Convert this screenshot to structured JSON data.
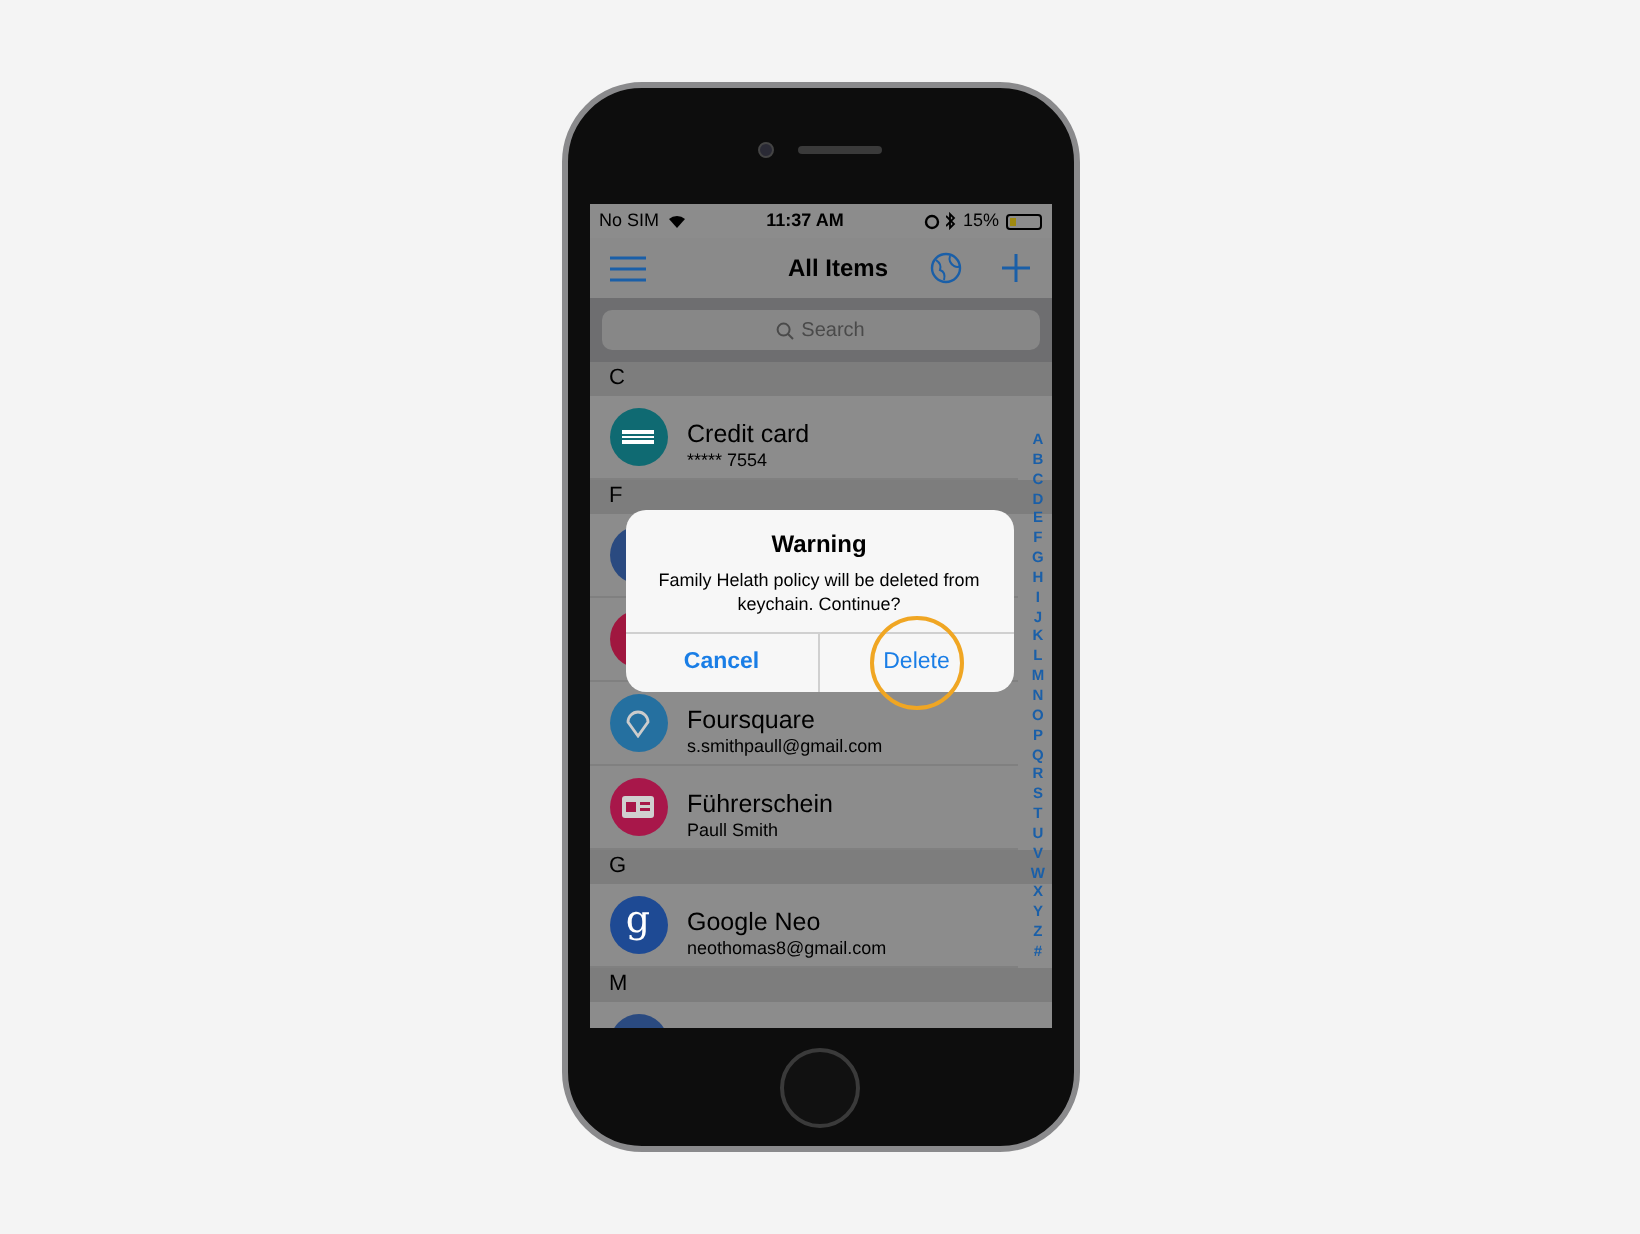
{
  "status_bar": {
    "carrier": "No SIM",
    "time": "11:37 AM",
    "battery": "15%"
  },
  "nav": {
    "title": "All Items"
  },
  "search": {
    "placeholder": "Search"
  },
  "sections": [
    {
      "letter": "C",
      "items": [
        {
          "kind": "card",
          "title": "Credit card",
          "subtitle": "***** 7554",
          "color": "#0f6a72"
        }
      ]
    },
    {
      "letter": "F",
      "items": [
        {
          "kind": "plain",
          "color": "#2a4a80"
        },
        {
          "kind": "plain",
          "color": "#a0173f"
        },
        {
          "kind": "pin",
          "title": "Foursquare",
          "subtitle": "s.smithpaull@gmail.com",
          "color": "#2570a0"
        },
        {
          "kind": "id",
          "title": "Führerschein",
          "subtitle": "Paull Smith",
          "color": "#a8174a"
        }
      ]
    },
    {
      "letter": "G",
      "items": [
        {
          "kind": "letter",
          "glyph": "g",
          "title": "Google Neo",
          "subtitle": "neothomas8@gmail.com",
          "color": "#1e4a94"
        }
      ]
    },
    {
      "letter": "M",
      "items": [
        {
          "kind": "plain",
          "color": "#2a4a80"
        }
      ]
    }
  ],
  "index": [
    "A",
    "B",
    "C",
    "D",
    "E",
    "F",
    "G",
    "H",
    "I",
    "J",
    "K",
    "L",
    "M",
    "N",
    "O",
    "P",
    "Q",
    "R",
    "S",
    "T",
    "U",
    "V",
    "W",
    "X",
    "Y",
    "Z",
    "#"
  ],
  "dialog": {
    "title": "Warning",
    "message": "Family Helath policy will be deleted from keychain. Continue?",
    "buttons": [
      {
        "label": "Cancel",
        "kind": "cancel",
        "highlighted": false
      },
      {
        "label": "Delete",
        "kind": "delete",
        "highlighted": true
      }
    ]
  }
}
